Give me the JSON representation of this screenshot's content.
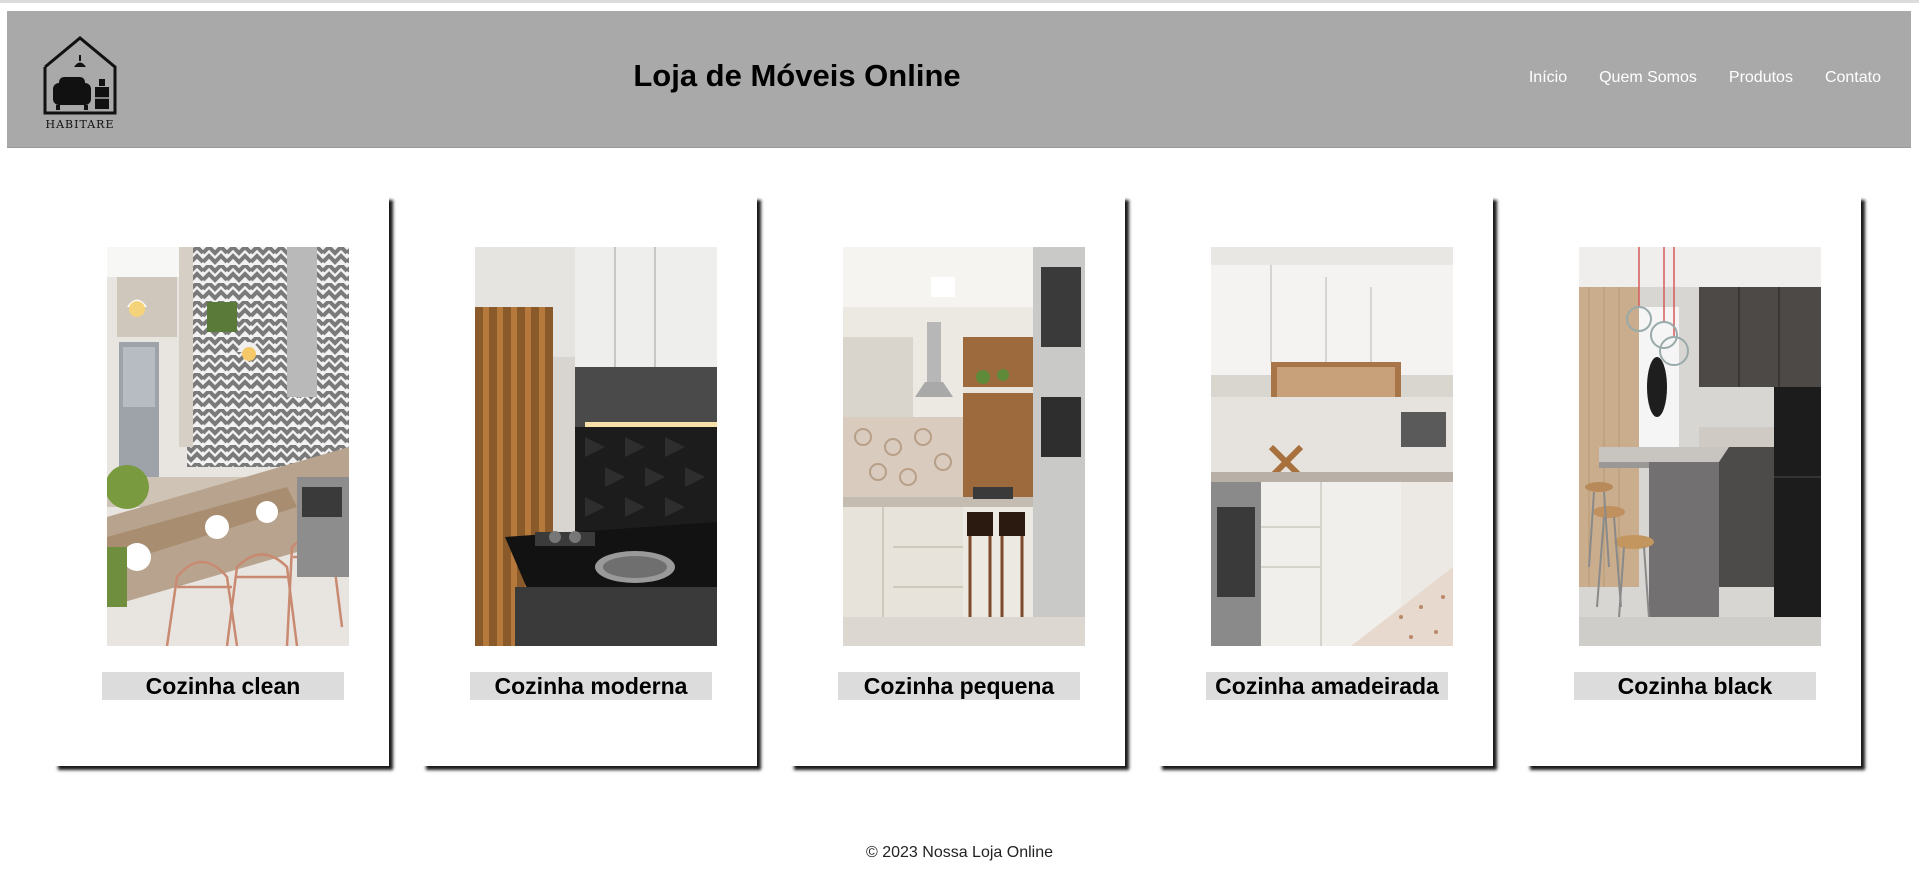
{
  "header": {
    "logo_text": "HABITARE",
    "title": "Loja de Móveis Online",
    "background": "#a9a9a9",
    "nav": [
      {
        "label": "Início"
      },
      {
        "label": "Quem Somos"
      },
      {
        "label": "Produtos"
      },
      {
        "label": "Contato"
      }
    ]
  },
  "products": [
    {
      "label": "Cozinha clean",
      "photo": "white-gray kitchen with chevron tile and copper wire stools"
    },
    {
      "label": "Cozinha moderna",
      "photo": "dark kitchen with wood slats and black tile"
    },
    {
      "label": "Cozinha pequena",
      "photo": "small beige kitchen with wood panel and bar stools"
    },
    {
      "label": "Cozinha amadeirada",
      "photo": "white kitchen with wooden shelves"
    },
    {
      "label": "Cozinha black",
      "photo": "gray kitchen with island, pendant lamps and black fridge"
    }
  ],
  "footer": {
    "text": "© 2023 Nossa Loja Online"
  }
}
